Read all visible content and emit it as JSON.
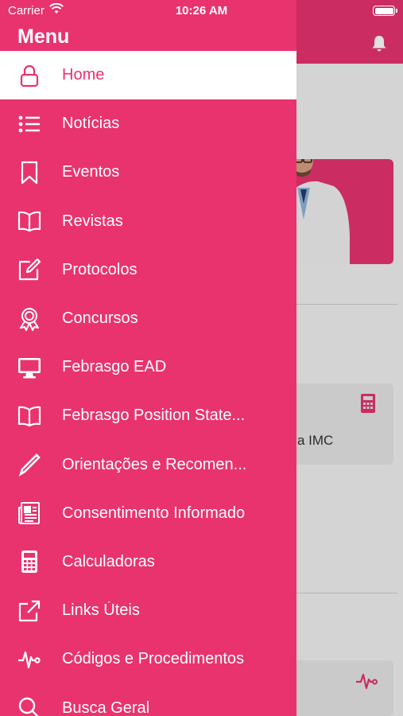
{
  "status_bar": {
    "carrier": "Carrier",
    "time": "10:26 AM"
  },
  "drawer": {
    "title": "Menu",
    "items": [
      {
        "label": "Home",
        "icon": "lock-icon",
        "active": true
      },
      {
        "label": "Notícias",
        "icon": "list-icon"
      },
      {
        "label": "Eventos",
        "icon": "bookmark-icon"
      },
      {
        "label": "Revistas",
        "icon": "book-icon"
      },
      {
        "label": "Protocolos",
        "icon": "edit-icon"
      },
      {
        "label": "Concursos",
        "icon": "award-icon"
      },
      {
        "label": "Febrasgo EAD",
        "icon": "monitor-icon"
      },
      {
        "label": "Febrasgo Position State...",
        "icon": "book-open-icon"
      },
      {
        "label": "Orientações e Recomen...",
        "icon": "pencil-icon"
      },
      {
        "label": "Consentimento Informado",
        "icon": "newspaper-icon"
      },
      {
        "label": "Calculadoras",
        "icon": "calculator-icon"
      },
      {
        "label": "Links Úteis",
        "icon": "external-link-icon"
      },
      {
        "label": "Códigos e Procedimentos",
        "icon": "pulse-icon"
      },
      {
        "label": "Busca Geral",
        "icon": "search-icon"
      }
    ]
  },
  "background": {
    "card_label": "a IMC"
  },
  "colors": {
    "brand": "#e8336f",
    "drawer_bg": "#e8336f",
    "active_bg": "#ffffff"
  }
}
